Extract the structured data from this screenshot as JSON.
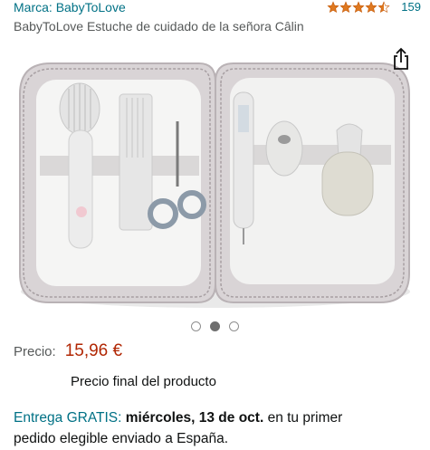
{
  "brand": {
    "prefix": "Marca: ",
    "name": "BabyToLove"
  },
  "rating": {
    "stars": 4.5,
    "count": "159"
  },
  "product": {
    "title": "BabyToLove Estuche de cuidado de la señora Câlin"
  },
  "image": {
    "total_images": 3,
    "active_index": 1
  },
  "price": {
    "label": "Precio:",
    "value": "15,96 €",
    "note": "Precio final del producto"
  },
  "delivery": {
    "label": "Entrega GRATIS:",
    "date": "miércoles, 13 de oct.",
    "rest_line1": "en tu primer",
    "rest_line2": "pedido elegible enviado a España."
  },
  "colors": {
    "link": "#007185",
    "price": "#b12704",
    "star": "#de7921"
  },
  "icons": {
    "share": "share-icon",
    "star": "star-icon"
  }
}
